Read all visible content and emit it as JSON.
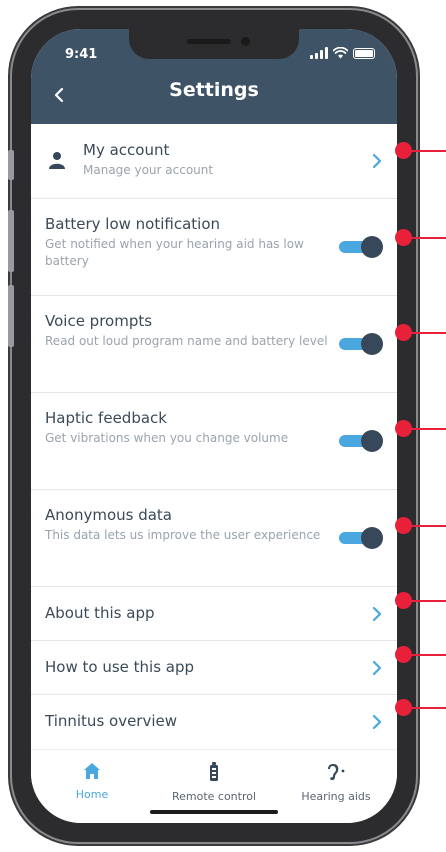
{
  "status_bar": {
    "time": "9:41"
  },
  "header": {
    "title": "Settings"
  },
  "settings": {
    "my_account": {
      "title": "My account",
      "subtitle": "Manage your account"
    },
    "battery_low": {
      "title": "Battery low notification",
      "subtitle": "Get notified when your hearing aid has low battery",
      "enabled": true
    },
    "voice_prompts": {
      "title": "Voice prompts",
      "subtitle": "Read out loud program name and battery level",
      "enabled": true
    },
    "haptic_feedback": {
      "title": "Haptic feedback",
      "subtitle": "Get vibrations when you change volume",
      "enabled": true
    },
    "anonymous_data": {
      "title": "Anonymous data",
      "subtitle": "This data lets us improve the user experience",
      "enabled": true
    },
    "about": {
      "title": "About this app"
    },
    "how_to_use": {
      "title": "How to use this app"
    },
    "tinnitus": {
      "title": "Tinnitus overview"
    }
  },
  "tabbar": {
    "home": "Home",
    "remote_control": "Remote control",
    "hearing_aids": "Hearing aids",
    "active_tab": "home"
  },
  "colors": {
    "header_bg": "#3f5366",
    "accent": "#4aa7e0",
    "toggle_knob": "#37485a",
    "callout": "#e8203a"
  },
  "icons": {
    "back": "chevron-left-icon",
    "account": "person-icon",
    "row_arrow": "chevron-right-icon",
    "home_tab": "house-icon",
    "remote_tab": "remote-control-icon",
    "hearing_tab": "ear-icon"
  }
}
